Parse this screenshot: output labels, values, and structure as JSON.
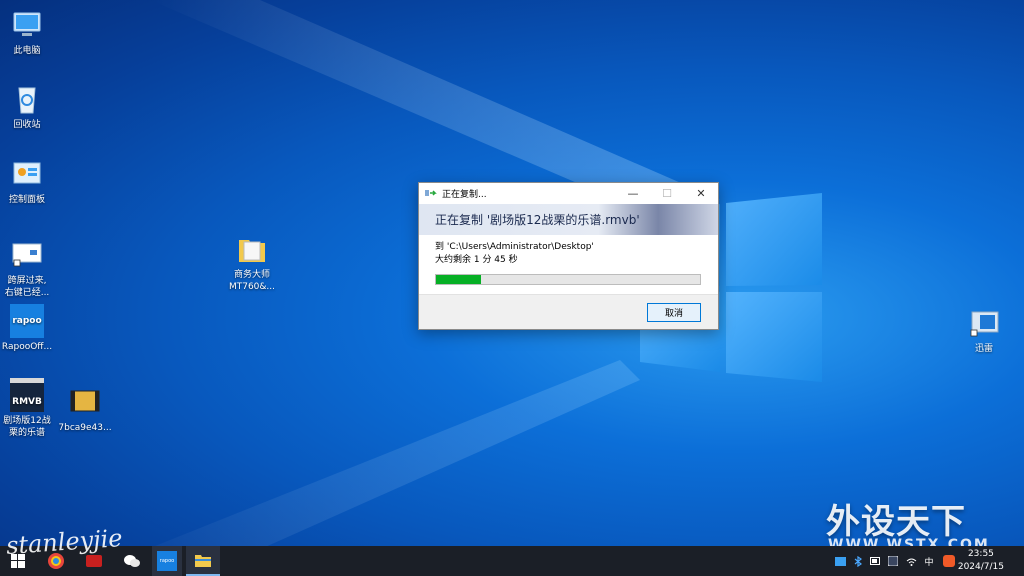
{
  "desktop": {
    "icons": [
      {
        "label": "此电脑"
      },
      {
        "label": "回收站"
      },
      {
        "label": "控制面板"
      },
      {
        "label": "跨屏过来,\n右键已经..."
      },
      {
        "label": "RapooOff..."
      },
      {
        "label": "剧场版12战\n栗的乐谱"
      },
      {
        "label": "7bca9e43..."
      },
      {
        "label": "商务大师\nMT760&..."
      },
      {
        "label": "迅雷"
      }
    ],
    "rmvb_badge": "RMVB",
    "rapoo_badge": "rapoo"
  },
  "dialog": {
    "title": "正在复制...",
    "minimize": "—",
    "maximize": "☐",
    "close": "✕",
    "header": "正在复制 '剧场版12战栗的乐谱.rmvb'",
    "destination": "到 'C:\\Users\\Administrator\\Desktop'",
    "time_remaining": "大约剩余 1 分 45 秒",
    "progress": 0.17,
    "cancel_label": "取消"
  },
  "taskbar": {
    "time": "23:55",
    "date": "2024/7/15",
    "ime": "中",
    "pinned": [
      "start",
      "browser",
      "app-red",
      "wechat",
      "rapoo",
      "file-explorer"
    ],
    "rapoo_label": "rapoo"
  },
  "watermark": {
    "brand": "外设天下",
    "url": "WWW.WSTX.COM",
    "signature": "stanleyjie"
  },
  "colors": {
    "accent": "#0078d7",
    "progress": "#06b025",
    "taskbar": "#1b1f27"
  }
}
